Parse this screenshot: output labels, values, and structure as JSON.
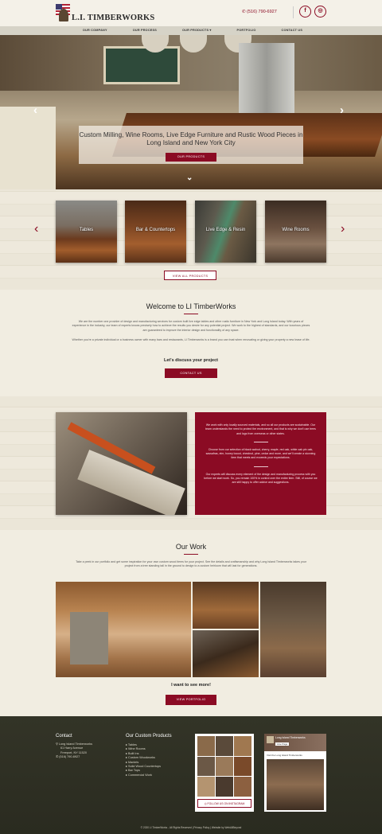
{
  "header": {
    "logo_text": "L.I. TIMBERWORKS",
    "phone": "(516) 790-6927",
    "social": [
      {
        "icon": "facebook-icon",
        "glyph": "f"
      },
      {
        "icon": "instagram-icon",
        "glyph": "◎"
      }
    ]
  },
  "nav": [
    "OUR COMPANY",
    "OUR PROCESS",
    "OUR PRODUCTS ▾",
    "PORTFOLIO",
    "CONTACT US"
  ],
  "hero": {
    "heading": "Custom Milling, Wine Rooms, Live Edge Furniture and Rustic Wood Pieces in Long Island and New York City",
    "button": "OUR PRODUCTS"
  },
  "categories": {
    "items": [
      "Tables",
      "Bar & Countertops",
      "Live Edge & Resin",
      "Wine Rooms"
    ],
    "button": "VIEW ALL PRODUCTS"
  },
  "welcome": {
    "title": "Welcome to LI TimberWorks",
    "p1": "We are the number one provider of design and manufacturing services for custom built live edge tables and other rustic furniture in New York and Long Island today. With years of experience in the industry, our team of experts knows precisely how to achieve the results you desire for any potential project. We work to the highest of standards, and our luxurious pieces are guaranteed to improve the interior design and functionality of any space.",
    "p2": "Whether you're a private individual or a business owner with many bars and restaurants, LI Timberworks is a brand you can trust when renovating or giving your property a new lease of life.",
    "cta_heading": "Let's discuss your project",
    "button": "CONTACT US"
  },
  "about": {
    "p1": "We work with only locally sourced materials, and so all our products are sustainable. Our team understands the need to protect the environment, and that is why we don't use trees and logs from overseas or other states.",
    "p2": "Choose from our selection of black walnut, cherry, maple, red oak, white oak pin oak, sassafras, elm, honey locust, chestnut, pine, cedar and more, and we'll create a stunning item that meets and exceeds your expectations.",
    "p3": "Our experts will discuss every element of the design and manufacturing process with you before we start work. So, you remain 100% in control over the entire item. Still, of course we are still happy to offer advice and suggestions."
  },
  "work": {
    "title": "Our Work",
    "text": "Take a peek in our portfolio and get some inspiration for your own custom wood items for your project. See the details and craftsmanship and why Long Island Timberworks takes your project from a tree standing tall in the ground to design to a custom heirloom that will last for generations.",
    "cta_heading": "I want to see more!",
    "button": "VIEW PORTFOLIO"
  },
  "footer": {
    "contact_title": "Contact",
    "address": [
      "Long Island Timberworks",
      "61 Harry Avenue",
      "Freeport, NY 11520"
    ],
    "phone": "(516) 790-6927",
    "products_title": "Our Custom Products",
    "products": [
      "Tables",
      "Wine Rooms",
      "Built Ins",
      "Custom Woodworks",
      "Mantels",
      "Solid Wood Countertops",
      "Bar Tops",
      "Commercial Work"
    ],
    "instagram_button": "FOLLOW US ON INSTAGRAM",
    "fb_page": "Long Island Timberworks",
    "fb_like": "Like Page",
    "fb_post": "Visit the Long Island Timberworks",
    "copyright": "© 2020 LI TimberWorks - All Rights Reserved  |  Privacy Policy  |  Website by WebAllBeyond"
  },
  "colors": {
    "brand": "#8b0b24",
    "cream": "#f1ede1",
    "footer": "#2e2f24"
  }
}
